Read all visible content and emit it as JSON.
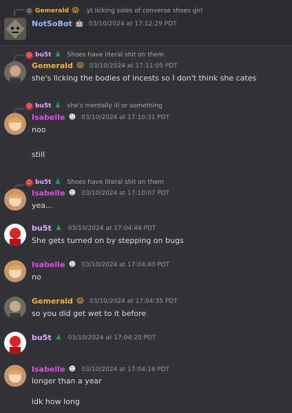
{
  "messages": {
    "top": {
      "reply_author": "Gemerald",
      "reply_text": ".yt licking soles of converse shoes girl",
      "author": "NotSoBot",
      "time": "03/10/2024 at 17:12:29 PDT"
    },
    "m1": {
      "reply_author": "bu5t",
      "reply_text": "Shoes have literal shit on them",
      "author": "Gemerald",
      "time": "03/10/2024 at 17:11:05 PDT",
      "text": "she's licking the bodies of incests so I don't think she cates"
    },
    "m2": {
      "reply_author": "bu5t",
      "reply_text": "she's mentally ill or something",
      "author": "Isabelle",
      "time": "03/10/2024 at 17:10:31 PDT",
      "text1": "noo",
      "text2": "still"
    },
    "m3": {
      "reply_author": "bu5t",
      "reply_text": "Shoes have literal shit on them",
      "author": "Isabelle",
      "time": "03/10/2024 at 17:10:07 PDT",
      "text": "yea..."
    },
    "m4": {
      "author": "bu5t",
      "time": "03/10/2024 at 17:04:44 PDT",
      "text": "She gets turned on by stepping on bugs"
    },
    "m5": {
      "author": "Isabelle",
      "time": "03/10/2024 at 17:04:40 PDT",
      "text": "no"
    },
    "m6": {
      "author": "Gemerald",
      "time": "03/10/2024 at 17:04:35 PDT",
      "text": "so you did get wet to it before"
    },
    "m7": {
      "author": "bu5t",
      "time": "03/10/2024 at 17:04:20 PDT"
    },
    "m8": {
      "author": "Isabelle",
      "time": "03/10/2024 at 17:04:16 PDT",
      "text1": "longer than a year",
      "text2": "idk how long"
    }
  },
  "colors": {
    "background": "#313338",
    "gemerald": "#f0b232",
    "isabelle": "#e04de7",
    "bu5t": "#e7a6ff",
    "notsobot": "#9ab7ff",
    "bu5t_badge": "#23a55a"
  },
  "icons": {
    "gemerald_badge": "scream-emoji-icon",
    "isabelle_badge": "trollface-icon",
    "bu5t_badge": "green-person-icon",
    "notsobot_badge": "bot-icon"
  }
}
